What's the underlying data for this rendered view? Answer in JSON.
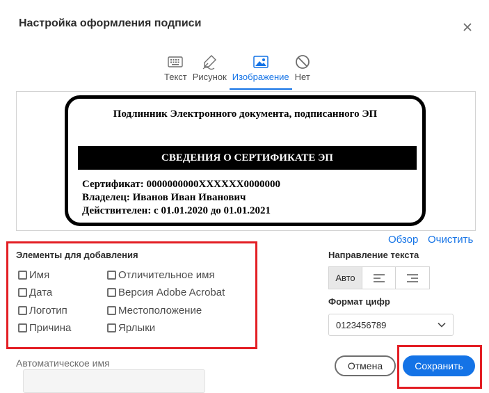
{
  "dialog": {
    "title": "Настройка оформления подписи"
  },
  "tabs": [
    {
      "label": "Текст",
      "icon": "keyboard-icon"
    },
    {
      "label": "Рисунок",
      "icon": "pen-icon"
    },
    {
      "label": "Изображение",
      "icon": "image-icon",
      "active": true
    },
    {
      "label": "Нет",
      "icon": "none-icon"
    }
  ],
  "preview": {
    "heading": "Подлинник Электронного документа, подписанного ЭП",
    "bar": "СВЕДЕНИЯ О СЕРТИФИКАТЕ ЭП",
    "lines": [
      "Сертификат: 0000000000XXXXXX0000000",
      "Владелец: Иванов Иван Иванович",
      "Действителен: с 01.01.2020 до 01.01.2021"
    ]
  },
  "links": {
    "browse": "Обзор",
    "clear": "Очистить"
  },
  "elements": {
    "title": "Элементы для добавления",
    "items": [
      "Имя",
      "Дата",
      "Логотип",
      "Причина",
      "Отличительное имя",
      "Версия Adobe Acrobat",
      "Местоположение",
      "Ярлыки"
    ]
  },
  "text_direction": {
    "title": "Направление текста",
    "auto": "Авто"
  },
  "number_format": {
    "title": "Формат цифр",
    "value": "0123456789"
  },
  "auto_name": {
    "label": "Автоматическое имя",
    "value": ""
  },
  "buttons": {
    "cancel": "Отмена",
    "save": "Сохранить"
  },
  "colors": {
    "accent": "#1473e6",
    "highlight_frame": "#e31e24"
  }
}
